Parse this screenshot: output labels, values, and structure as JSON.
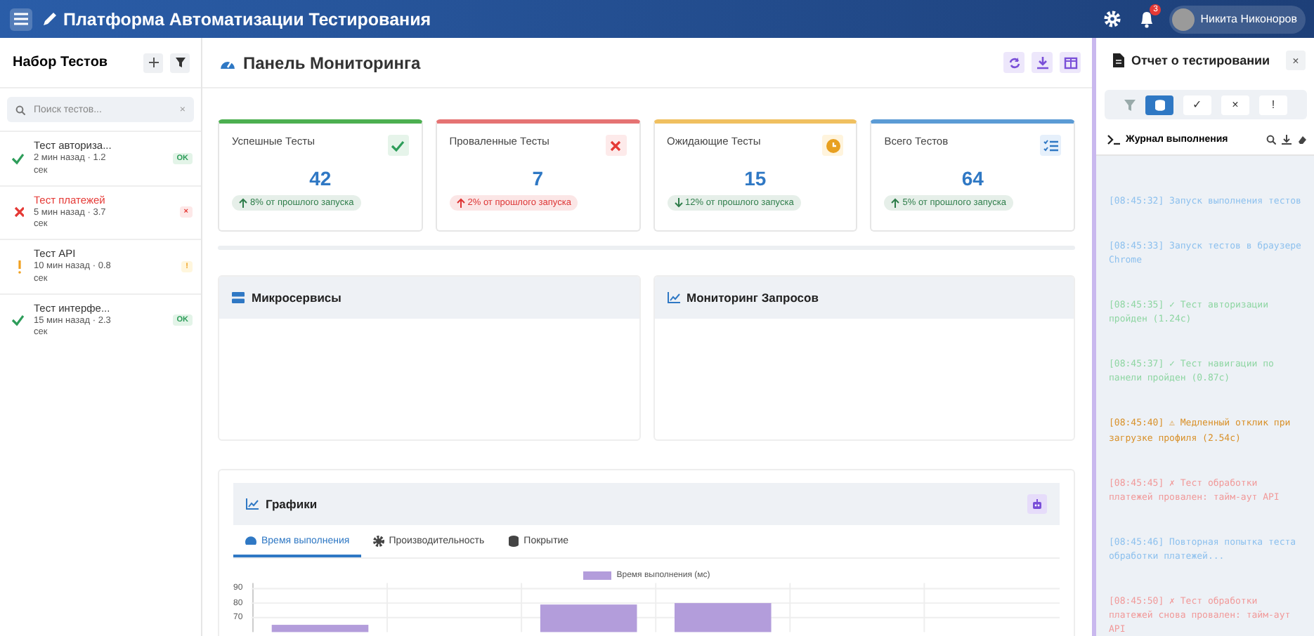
{
  "header": {
    "title": "Платформа Автоматизации Тестирования",
    "notifications": "3",
    "user": "Никита Никоноров"
  },
  "sidebar": {
    "title": "Набор Тестов",
    "search": {
      "placeholder": "Поиск тестов..."
    },
    "clear": "×",
    "tests": [
      {
        "kind": "success",
        "name": "Тест авториза...",
        "meta": "2 мин назад · 1.2 сек",
        "badge": "OK"
      },
      {
        "kind": "error",
        "name": "Тест платежей",
        "meta": "5 мин назад · 3.7 сек",
        "badge": "×"
      },
      {
        "kind": "warning",
        "name": "Тест API",
        "meta": "10 мин назад · 0.8 сек",
        "badge": "!"
      },
      {
        "kind": "success",
        "name": "Тест интерфе...",
        "meta": "15 мин назад · 2.3 сек",
        "badge": "OK"
      }
    ]
  },
  "dashboard": {
    "title": "Панель Мониторинга",
    "stats": [
      {
        "kind": "success",
        "label": "Успешные Тесты",
        "value": "42",
        "trend": {
          "kind": "up",
          "text": "8% от прошлого запуска",
          "color": "#2e7d4a"
        }
      },
      {
        "kind": "failed",
        "label": "Проваленные Тесты",
        "value": "7",
        "trend": {
          "kind": "up",
          "text": "2% от прошлого запуска",
          "color": "#dd3333"
        }
      },
      {
        "kind": "pending",
        "label": "Ожидающие Тесты",
        "value": "15",
        "trend": {
          "kind": "down",
          "text": "12% от прошлого запуска",
          "color": "#2e7d4a"
        }
      },
      {
        "kind": "total",
        "label": "Всего Тестов",
        "value": "64",
        "trend": {
          "kind": "up",
          "text": "5% от прошлого запуска",
          "color": "#2e7d4a"
        }
      }
    ],
    "panels": [
      {
        "kind": "services",
        "title": "Микросервисы"
      },
      {
        "kind": "requests",
        "title": "Мониторинг Запросов"
      }
    ],
    "charts": {
      "title": "Графики",
      "tabs": [
        {
          "kind": "time",
          "label": "Время выполнения",
          "selected": true
        },
        {
          "kind": "performance",
          "label": "Производительность",
          "selected": false
        },
        {
          "kind": "coverage",
          "label": "Покрытие",
          "selected": false
        }
      ],
      "chart_data": {
        "type": "bar",
        "ylim": [
          60,
          90
        ],
        "yticks": [
          70,
          80,
          90
        ],
        "series": [
          {
            "name": "Время выполнения (мс)",
            "color": "#b39ddb",
            "values": [
              65,
              null,
              79,
              80,
              null,
              null
            ]
          }
        ]
      }
    }
  },
  "report": {
    "title": "Отчет о тестировании",
    "close": "×",
    "filters": [
      {
        "kind": "all",
        "selected": true
      },
      {
        "kind": "success",
        "label": "✓",
        "selected": false
      },
      {
        "kind": "error",
        "label": "×",
        "selected": false
      },
      {
        "kind": "warning",
        "label": "!",
        "selected": false
      }
    ],
    "log_title": "Журнал выполнения",
    "log": [
      {
        "kind": "info",
        "text": "[08:45:32] Запуск выполнения тестов"
      },
      {
        "kind": "info",
        "text": "[08:45:33] Запуск тестов в браузере Chrome"
      },
      {
        "kind": "success",
        "text": "[08:45:35] ✓ Тест авторизации пройден (1.24с)"
      },
      {
        "kind": "success",
        "text": "[08:45:37] ✓ Тест навигации по панели пройден (0.87с)"
      },
      {
        "kind": "warning",
        "text": "[08:45:40] ⚠ Медленный отклик при загрузке профиля (2.54с)"
      },
      {
        "kind": "error",
        "text": "[08:45:45] ✗ Тест обработки платежей провален: тайм-аут API"
      },
      {
        "kind": "info",
        "text": "[08:45:46] Повторная попытка теста обработки платежей..."
      },
      {
        "kind": "error",
        "text": "[08:45:50] ✗ Тест обработки платежей снова провален: тайм-аут API"
      }
    ]
  }
}
